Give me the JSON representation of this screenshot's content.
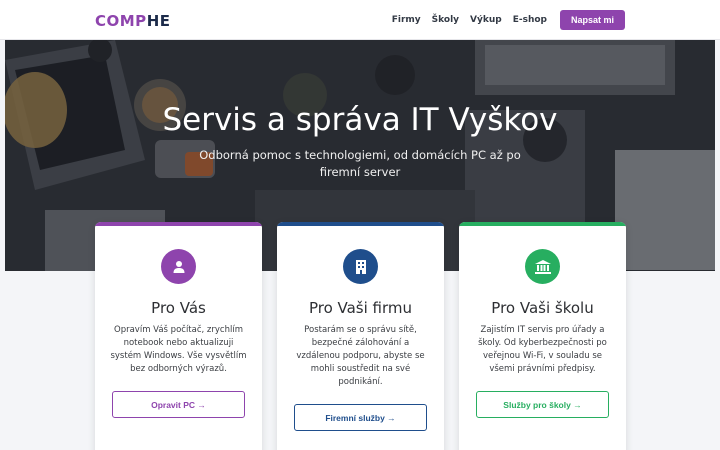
{
  "nav": {
    "logo_part1": "COMP",
    "logo_part2": "HE",
    "links": [
      "Firmy",
      "Školy",
      "Výkup",
      "E-shop"
    ],
    "cta": "Napsat mi"
  },
  "hero": {
    "title": "Servis a správa IT Vyškov",
    "subtitle": "Odborná pomoc s technologiemi, od domácích PC až po firemní server"
  },
  "cards": [
    {
      "title": "Pro Vás",
      "icon": "user-icon",
      "color": "#8e44ad",
      "description": "Opravím Váš počítač, zrychlím notebook nebo aktualizuji systém Windows. Vše vysvětlím bez odborných výrazů.",
      "button": "Opravit PC →"
    },
    {
      "title": "Pro Vaši firmu",
      "icon": "building-icon",
      "color": "#1f4e8c",
      "description": "Postarám se o správu sítě, bezpečné zálohování a vzdálenou podporu, abyste se mohli soustředit na své podnikání.",
      "button": "Firemní služby →"
    },
    {
      "title": "Pro Vaši školu",
      "icon": "school-icon",
      "color": "#27ae60",
      "description": "Zajistím IT servis pro úřady a školy. Od kyberbezpečnosti po veřejnou Wi-Fi, v souladu se všemi právními předpisy.",
      "button": "Služby pro školy →"
    }
  ]
}
